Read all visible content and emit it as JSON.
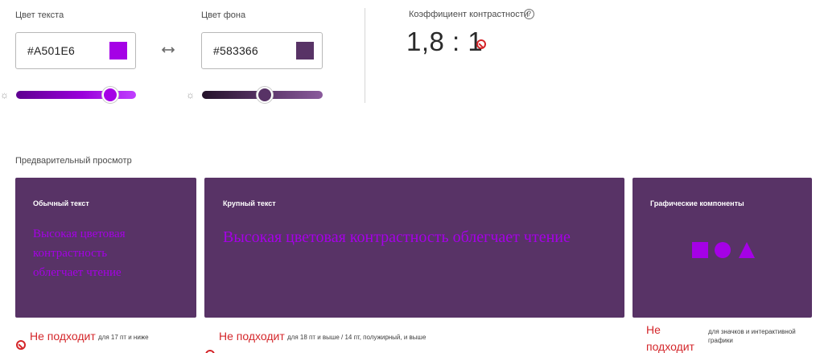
{
  "colors": {
    "text": "#A501E6",
    "background": "#583366",
    "fail": "#D4262A",
    "label": "#4B4B4B"
  },
  "text_color": {
    "label": "Цвет текста",
    "hex": "#A501E6",
    "lightness_percent": 79
  },
  "swap": {
    "icon": "swap-arrows-icon"
  },
  "bg_color": {
    "label": "Цвет фона",
    "hex": "#583366",
    "lightness_percent": 52
  },
  "contrast": {
    "title": "Коэффициент контрастности",
    "help_symbol": "?",
    "ratio": "1,8 : 1",
    "status_icon": "fail-icon"
  },
  "preview": {
    "title": "Предварительный просмотр",
    "cards": [
      {
        "title": "Обычный текст",
        "sample": "Высокая цветовая контрастность облегчает чтение",
        "result": "Не подходит",
        "note": "для 17 пт и ниже"
      },
      {
        "title": "Крупный текст",
        "sample": "Высокая цветовая контрастность облегчает чтение",
        "result": "Не подходит",
        "note": "для 18 пт и выше / 14 пт, полужирный, и выше"
      },
      {
        "title": "Графические компоненты",
        "shapes": [
          "square-shape",
          "circle-shape",
          "triangle-shape"
        ],
        "result": "Не подходит",
        "note": "для значков и интерактивной графики"
      }
    ]
  }
}
